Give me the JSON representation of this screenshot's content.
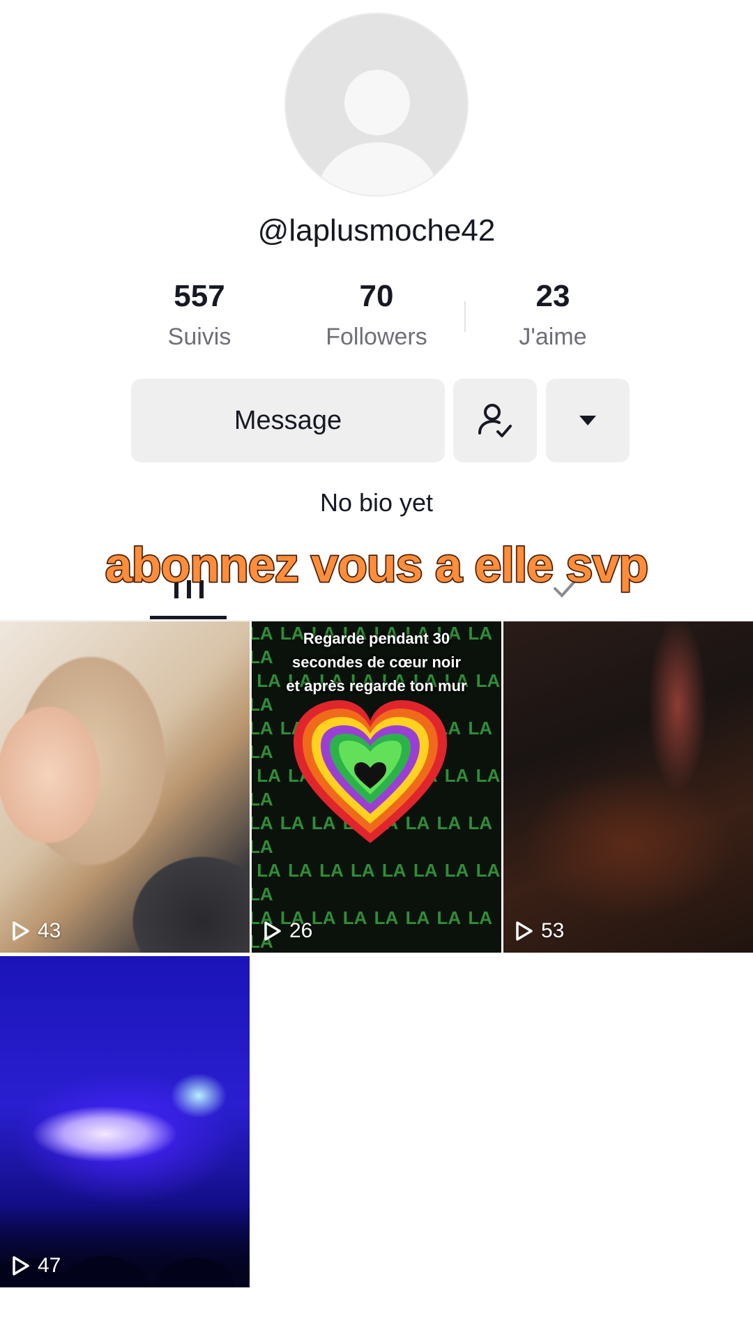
{
  "profile": {
    "username": "@laplusmoche42",
    "bio": "No bio yet"
  },
  "stats": [
    {
      "value": "557",
      "label": "Suivis"
    },
    {
      "value": "70",
      "label": "Followers"
    },
    {
      "value": "23",
      "label": "J'aime"
    }
  ],
  "actions": {
    "message_label": "Message",
    "follow_icon": "user-check-icon",
    "more_icon": "caret-down-icon"
  },
  "overlay_text": "abonnez vous a elle svp",
  "tabs": [
    {
      "icon": "videos-grid-icon",
      "active": true
    },
    {
      "icon": "liked-icon",
      "active": false
    }
  ],
  "videos": [
    {
      "views": "43"
    },
    {
      "views": "26",
      "caption": [
        "Regarde pendant 30",
        "secondes de cœur noir",
        "et après regarde ton mur"
      ],
      "pattern_text": "LA"
    },
    {
      "views": "53"
    },
    {
      "views": "47"
    }
  ],
  "colors": {
    "overlay_text": "#ff8d3a",
    "button_bg": "#efefef",
    "muted_text": "#6e6f76"
  }
}
